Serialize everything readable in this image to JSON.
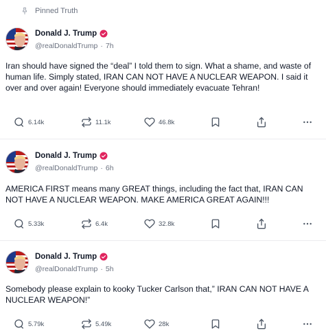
{
  "pinned": {
    "label": "Pinned Truth",
    "icon": "pin-icon"
  },
  "colors": {
    "verified": "#e0245e",
    "text": "#111827",
    "muted": "#6b7280"
  },
  "posts": [
    {
      "author": {
        "display_name": "Donald J. Trump",
        "handle": "@realDonaldTrump",
        "separator": "·",
        "time": "7h"
      },
      "text": "Iran should have signed the “deal” I told them to sign. What a shame, and waste of human life. Simply stated, IRAN CAN NOT HAVE A NUCLEAR WEAPON. I said it over and over again! Everyone should immediately evacuate Tehran!",
      "stats": {
        "replies": "6.14k",
        "retruths": "11.1k",
        "likes": "46.8k"
      }
    },
    {
      "author": {
        "display_name": "Donald J. Trump",
        "handle": "@realDonaldTrump",
        "separator": "·",
        "time": "6h"
      },
      "text": "AMERICA FIRST means many GREAT things, including the fact that, IRAN CAN NOT HAVE A NUCLEAR WEAPON. MAKE AMERICA GREAT AGAIN!!!",
      "stats": {
        "replies": "5.33k",
        "retruths": "6.4k",
        "likes": "32.8k"
      }
    },
    {
      "author": {
        "display_name": "Donald J. Trump",
        "handle": "@realDonaldTrump",
        "separator": "·",
        "time": "5h"
      },
      "text": "Somebody please explain to kooky Tucker Carlson that,” IRAN CAN NOT HAVE A NUCLEAR WEAPON!”",
      "stats": {
        "replies": "5.79k",
        "retruths": "5.49k",
        "likes": "28k"
      }
    }
  ]
}
